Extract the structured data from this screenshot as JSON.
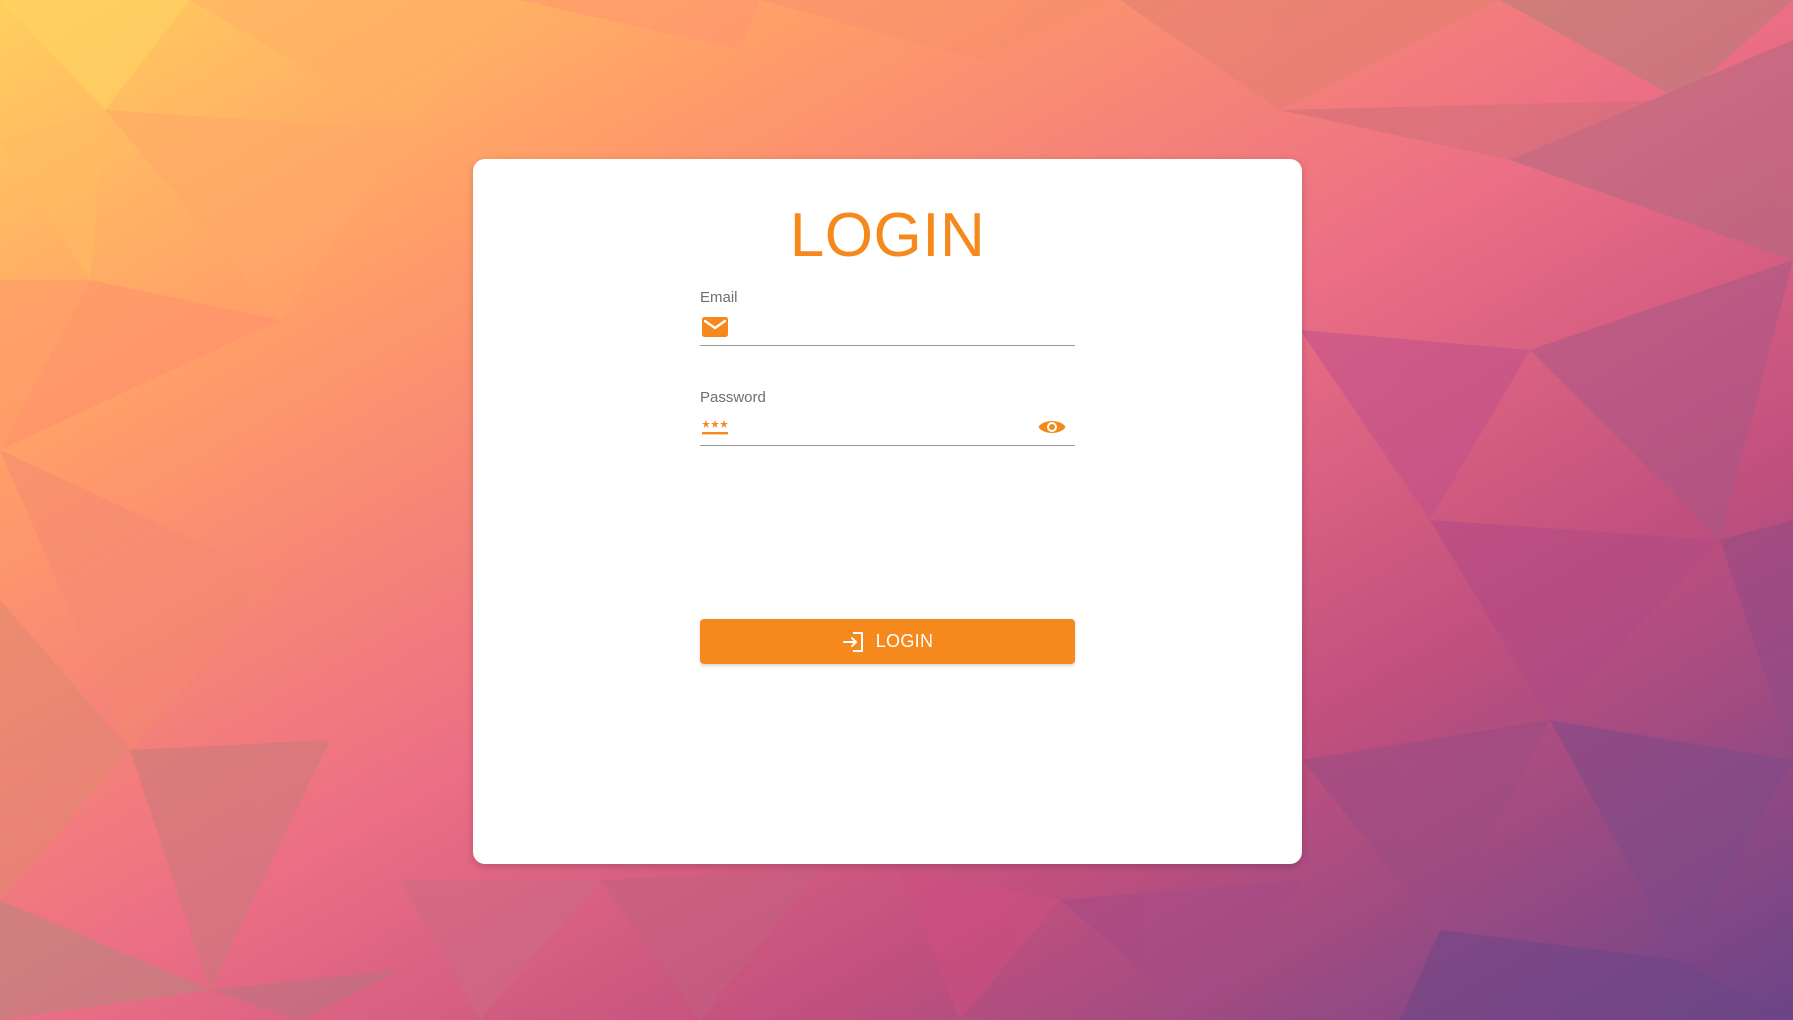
{
  "theme": {
    "accent": "#f5891e",
    "card_background": "#ffffff",
    "label_color": "#6f6f6f"
  },
  "login_card": {
    "title": "LOGIN",
    "email_field": {
      "label": "Email",
      "value": "",
      "icon": "email-icon"
    },
    "password_field": {
      "label": "Password",
      "value": "",
      "icon": "password-icon",
      "toggle_icon": "eye-icon"
    },
    "submit_button": {
      "label": "LOGIN",
      "icon": "login-icon"
    }
  }
}
